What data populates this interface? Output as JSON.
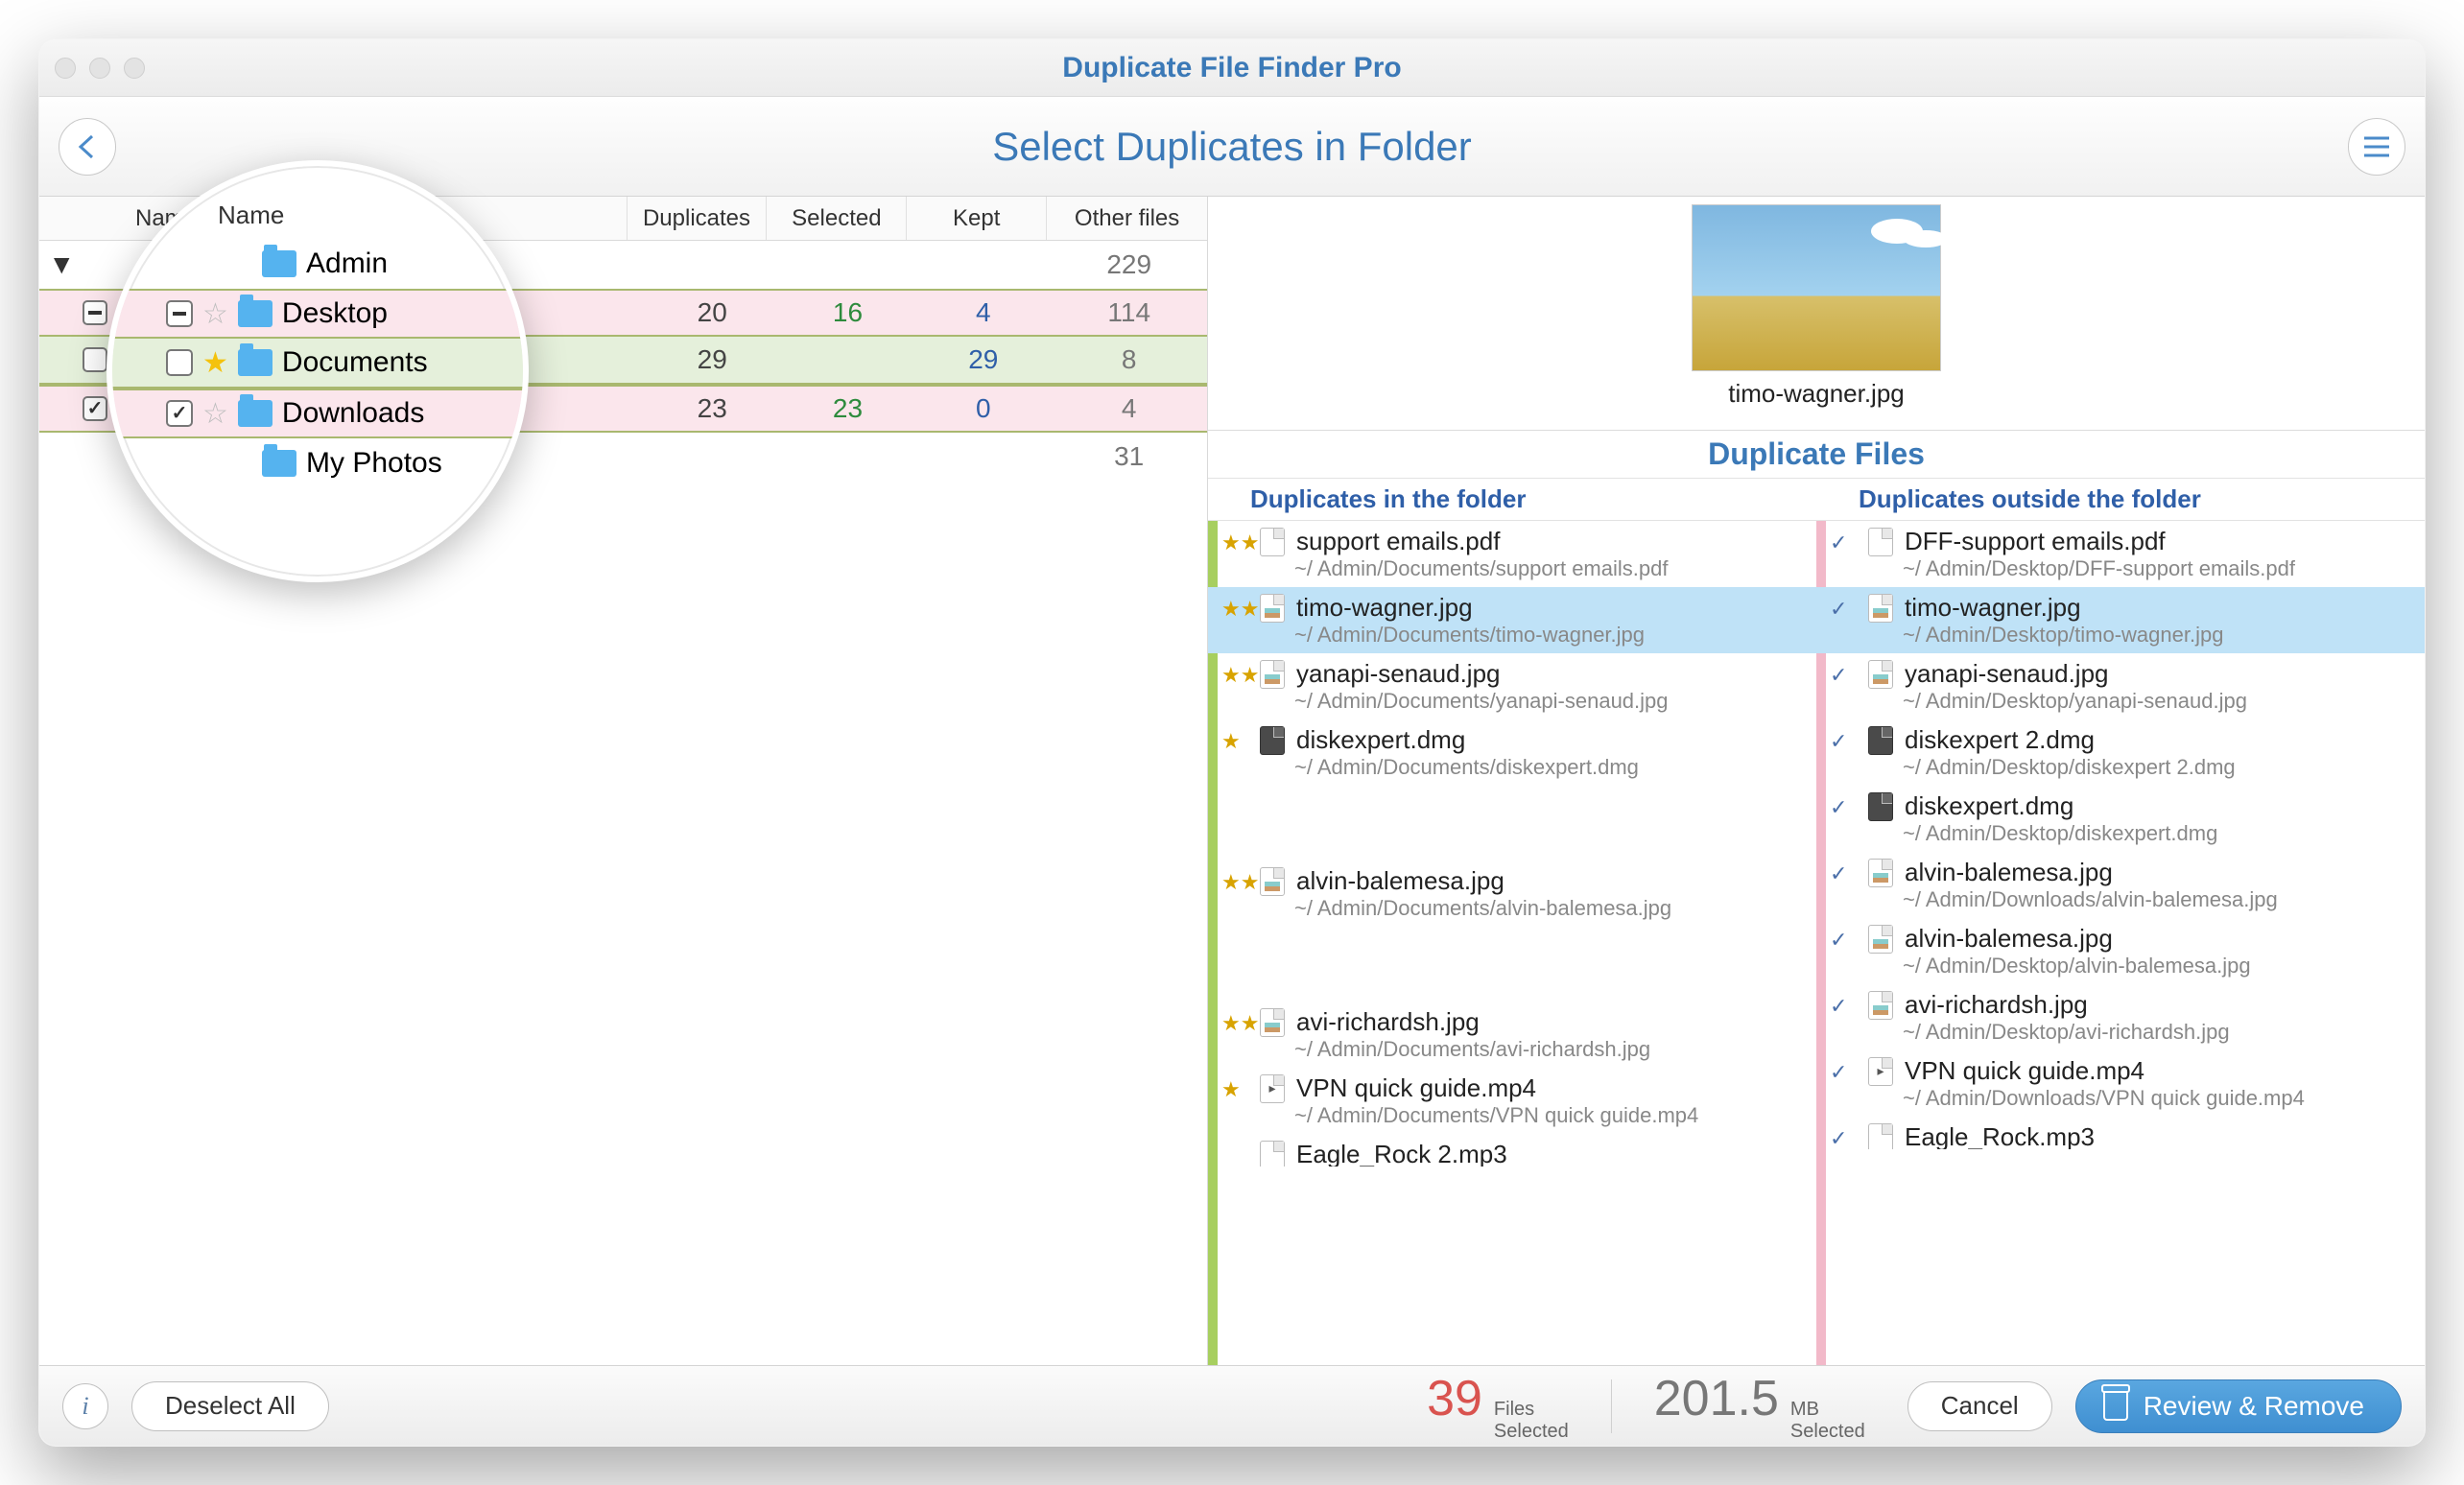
{
  "window": {
    "title": "Duplicate File Finder Pro"
  },
  "toolbar": {
    "subtitle": "Select Duplicates in Folder"
  },
  "columns": {
    "name": "Name",
    "duplicates": "Duplicates",
    "selected": "Selected",
    "kept": "Kept",
    "other": "Other files"
  },
  "folders": [
    {
      "name": "Admin",
      "kind": "parent",
      "other": "229"
    },
    {
      "name": "Desktop",
      "kind": "pink",
      "check": "mixed",
      "star": "empty",
      "dup": "20",
      "sel": "16",
      "kept": "4",
      "other": "114"
    },
    {
      "name": "Documents",
      "kind": "green",
      "check": "empty",
      "star": "gold",
      "dup": "29",
      "sel": "",
      "kept": "29",
      "other": "8"
    },
    {
      "name": "Downloads",
      "kind": "pink",
      "check": "checked",
      "star": "empty",
      "dup": "23",
      "sel": "23",
      "kept": "0",
      "other": "4"
    },
    {
      "name": "My Photos",
      "kind": "plain",
      "other": "31"
    }
  ],
  "preview": {
    "filename": "timo-wagner.jpg"
  },
  "dupSection": {
    "title": "Duplicate Files",
    "inHeader": "Duplicates in the folder",
    "outHeader": "Duplicates outside the folder"
  },
  "inList": [
    {
      "mark": "★★",
      "icon": "doc",
      "name": "support emails.pdf",
      "path": "~/ Admin/Documents/support emails.pdf"
    },
    {
      "mark": "★★",
      "icon": "img",
      "name": "timo-wagner.jpg",
      "path": "~/ Admin/Documents/timo-wagner.jpg",
      "selected": true
    },
    {
      "mark": "★★",
      "icon": "img",
      "name": "yanapi-senaud.jpg",
      "path": "~/ Admin/Documents/yanapi-senaud.jpg"
    },
    {
      "mark": "★",
      "icon": "dmg",
      "name": "diskexpert.dmg",
      "path": "~/ Admin/Documents/diskexpert.dmg"
    },
    {
      "mark": "",
      "icon": "",
      "name": "",
      "path": "",
      "spacer": true
    },
    {
      "mark": "★★",
      "icon": "img",
      "name": "alvin-balemesa.jpg",
      "path": "~/ Admin/Documents/alvin-balemesa.jpg"
    },
    {
      "mark": "",
      "icon": "",
      "name": "",
      "path": "",
      "spacer": true
    },
    {
      "mark": "★★",
      "icon": "img",
      "name": "avi-richardsh.jpg",
      "path": "~/ Admin/Documents/avi-richardsh.jpg"
    },
    {
      "mark": "★",
      "icon": "vid",
      "name": "VPN quick guide.mp4",
      "path": "~/ Admin/Documents/VPN quick guide.mp4"
    },
    {
      "mark": "",
      "icon": "",
      "name": "Eagle_Rock 2.mp3",
      "path": "",
      "cut": true
    }
  ],
  "outList": [
    {
      "mark": "✓",
      "icon": "doc",
      "name": "DFF-support emails.pdf",
      "path": "~/ Admin/Desktop/DFF-support emails.pdf"
    },
    {
      "mark": "✓",
      "icon": "img",
      "name": "timo-wagner.jpg",
      "path": "~/ Admin/Desktop/timo-wagner.jpg",
      "selected": true
    },
    {
      "mark": "✓",
      "icon": "img",
      "name": "yanapi-senaud.jpg",
      "path": "~/ Admin/Desktop/yanapi-senaud.jpg"
    },
    {
      "mark": "✓",
      "icon": "dmg",
      "name": "diskexpert 2.dmg",
      "path": "~/ Admin/Desktop/diskexpert 2.dmg"
    },
    {
      "mark": "✓",
      "icon": "dmg",
      "name": "diskexpert.dmg",
      "path": "~/ Admin/Desktop/diskexpert.dmg"
    },
    {
      "mark": "✓",
      "icon": "img",
      "name": "alvin-balemesa.jpg",
      "path": "~/ Admin/Downloads/alvin-balemesa.jpg"
    },
    {
      "mark": "✓",
      "icon": "img",
      "name": "alvin-balemesa.jpg",
      "path": "~/ Admin/Desktop/alvin-balemesa.jpg"
    },
    {
      "mark": "✓",
      "icon": "img",
      "name": "avi-richardsh.jpg",
      "path": "~/ Admin/Desktop/avi-richardsh.jpg"
    },
    {
      "mark": "✓",
      "icon": "vid",
      "name": "VPN quick guide.mp4",
      "path": "~/ Admin/Downloads/VPN quick guide.mp4"
    },
    {
      "mark": "✓",
      "icon": "",
      "name": "Eagle_Rock.mp3",
      "path": "",
      "cut": true
    }
  ],
  "footer": {
    "deselect": "Deselect All",
    "cancel": "Cancel",
    "review": "Review & Remove",
    "filesCount": "39",
    "filesUnitTop": "Files",
    "filesUnitBot": "Selected",
    "sizeCount": "201.5",
    "sizeUnitTop": "MB",
    "sizeUnitBot": "Selected"
  }
}
